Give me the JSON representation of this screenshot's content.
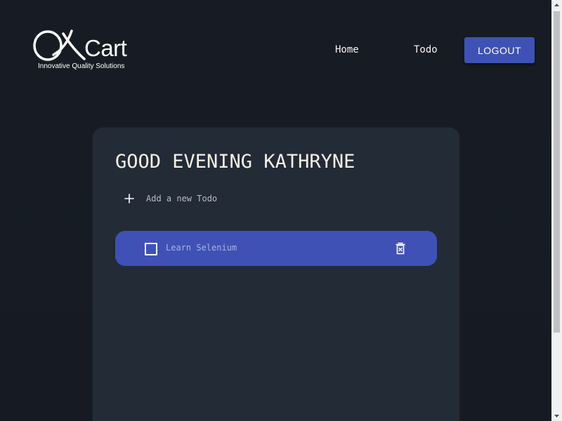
{
  "header": {
    "logo": {
      "wordmark": "Cart",
      "tagline": "Innovative Quality Solutions"
    },
    "nav": {
      "home_label": "Home",
      "todo_label": "Todo"
    },
    "logout_label": "LOGOUT"
  },
  "card": {
    "greeting": "GOOD EVENING KATHRYNE",
    "add_todo": {
      "placeholder": "Add a new Todo"
    },
    "todos": [
      {
        "label": "Learn Selenium",
        "done": false
      }
    ]
  },
  "colors": {
    "background": "#171c24",
    "card": "#232b37",
    "accent": "#3f51b5",
    "text": "#f3f0e6"
  },
  "icons": {
    "add": "plus-icon",
    "checkbox": "checkbox-icon",
    "delete": "trash-icon"
  }
}
